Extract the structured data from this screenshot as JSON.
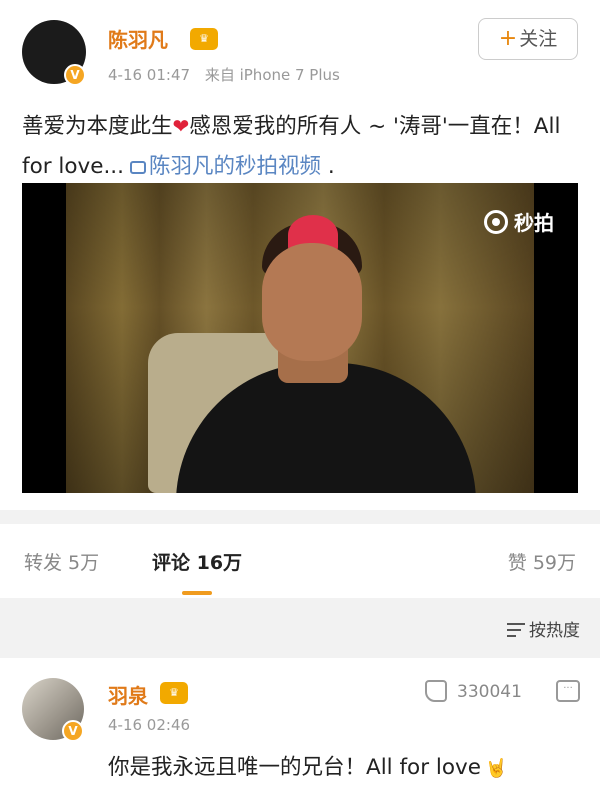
{
  "post": {
    "username": "陈羽凡",
    "timestamp": "4-16 01:47",
    "source": "来自 iPhone 7 Plus",
    "follow_label": "关注",
    "follow_plus": "+",
    "text_before_heart": "善爱为本度此生",
    "text_after_heart": "感恩爱我的所有人 ~ '涛哥'一直在！All for love...",
    "video_link_text": "陈羽凡的秒拍视频",
    "text_end": " .",
    "heart_glyph": "❤",
    "video_watermark": "秒拍"
  },
  "stats": {
    "repost": "转发 5万",
    "comments": "评论 16万",
    "likes": "赞 59万"
  },
  "sort_label": "按热度",
  "comment": {
    "username": "羽泉",
    "timestamp": "4-16 02:46",
    "like_count": "330041",
    "text": "你是我永远且唯一的兄台！All for love",
    "emoji_glyph": "🤘"
  },
  "colors": {
    "username": "#e07a19",
    "link": "#5a86c2",
    "tab_underline": "#f09b1e",
    "verified_badge": "#f5a623"
  },
  "icons": {
    "verified": "verified-badge-icon",
    "member": "crown-icon",
    "video_link": "video-link-icon",
    "watermark": "miaopai-icon",
    "sort": "sort-lines-icon",
    "like": "thumb-up-icon",
    "reply": "comment-bubble-icon"
  }
}
